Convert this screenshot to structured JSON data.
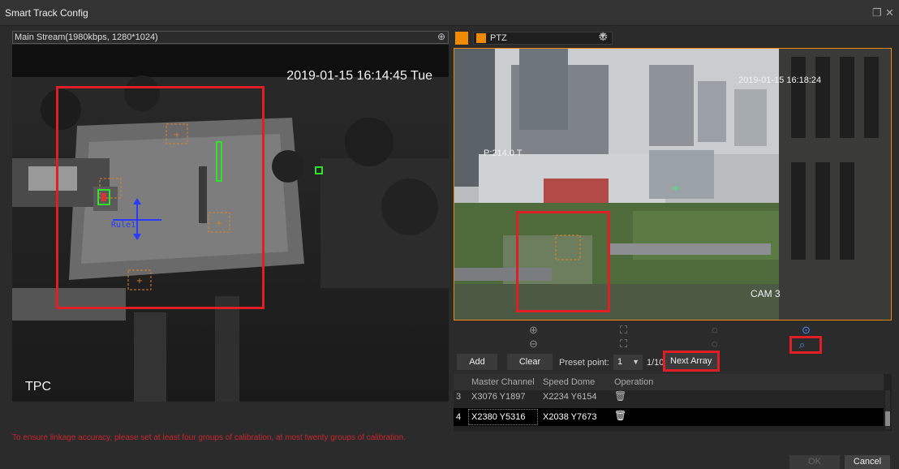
{
  "window": {
    "title": "Smart Track Config",
    "restore_glyph": "❐",
    "close_glyph": "✕"
  },
  "left_panel": {
    "stream_label": "Main Stream(1980kbps, 1280*1024)",
    "zoom_glyph": "⊕",
    "timestamp": "2019-01-15 16:14:45 Tue",
    "camera_label": "TPC",
    "rule_label": "Rule1"
  },
  "right_panel": {
    "channel": "PTZ",
    "timestamp": "2019-01-15 16:18:24",
    "overlay_text": "P:214.0 T",
    "camera_label": "CAM 3"
  },
  "ptz_controls": {
    "icons": [
      "zoom-in-icon",
      "zoom-out-icon",
      "focus-near-icon",
      "focus-far-icon",
      "iris-open-icon",
      "iris-close-icon",
      "mouse-locate-icon",
      "area-zoom-icon"
    ]
  },
  "toolbar": {
    "add_label": "Add",
    "clear_label": "Clear",
    "preset_label": "Preset point:",
    "preset_value": "1",
    "preset_count": "1/10",
    "next_array_label": "Next Array"
  },
  "table": {
    "headers": [
      "Master Channel",
      "Speed Dome",
      "Operation"
    ],
    "rows": [
      {
        "index": "3",
        "master": "X3076 Y1897",
        "dome": "X2234 Y6154"
      },
      {
        "index": "4",
        "master": "X2380 Y5316",
        "dome": "X2038 Y7673"
      }
    ]
  },
  "hint": "To ensure linkage accuracy, please set at least four groups of calibration, at most twenty groups of calibration.",
  "footer": {
    "ok_label": "OK",
    "cancel_label": "Cancel"
  },
  "colors": {
    "accent": "#f08a00",
    "highlight_red": "#e01e25",
    "active_blue": "#4a8cff",
    "hint_red": "#c4262c"
  }
}
